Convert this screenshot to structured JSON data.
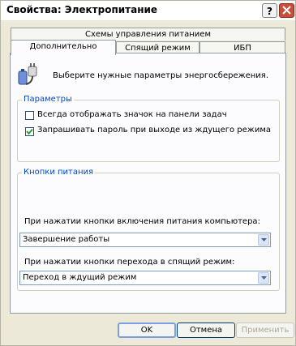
{
  "window": {
    "title": "Свойства: Электропитание"
  },
  "tabs": {
    "row1": [
      "Схемы управления питанием"
    ],
    "row2": [
      "Дополнительно",
      "Спящий режим",
      "ИБП"
    ],
    "active": "Дополнительно"
  },
  "intro": {
    "text": "Выберите нужные параметры энергосбережения."
  },
  "params": {
    "label": "Параметры",
    "show_icon": {
      "label": "Всегда отображать значок на панели задач",
      "checked": false
    },
    "ask_password": {
      "label": "Запрашивать пароль при выходе из ждущего режима",
      "checked": true
    }
  },
  "power_buttons": {
    "label": "Кнопки питания",
    "power_button": {
      "label": "При нажатии кнопки включения питания компьютера:",
      "value": "Завершение работы"
    },
    "sleep_button": {
      "label": "При нажатии кнопки перехода в спящий режим:",
      "value": "Переход в ждущий режим"
    }
  },
  "buttons": {
    "ok": "OK",
    "cancel": "Отмена",
    "apply": "Применить"
  },
  "colors": {
    "close": "#c94f3b",
    "group_label": "#0046d5",
    "dialog_bg": "#ece9d8"
  },
  "icons": {
    "help": "question-mark-icon",
    "close": "close-x-icon",
    "power": "power-plug-battery-icon"
  }
}
